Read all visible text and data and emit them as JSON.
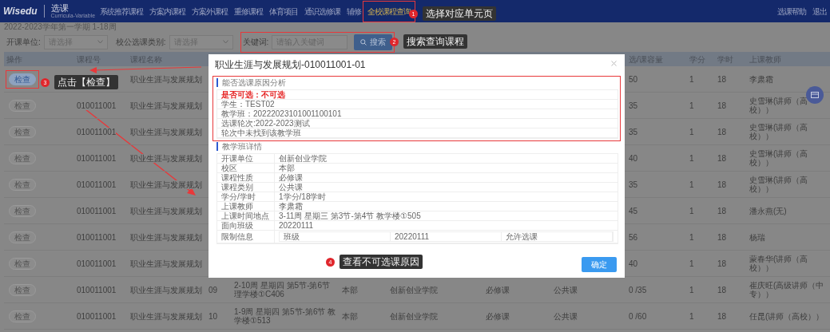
{
  "nav": {
    "brand": "Wisedu",
    "app": "选课",
    "app_subtitle": "Curricula-Variable",
    "items": [
      {
        "label": "系统推荐课程",
        "selected": false
      },
      {
        "label": "方案内课程",
        "selected": false
      },
      {
        "label": "方案外课程",
        "selected": false
      },
      {
        "label": "重修课程",
        "selected": false
      },
      {
        "label": "体育项目",
        "selected": false
      },
      {
        "label": "通识选修课",
        "selected": false
      },
      {
        "label": "辅修",
        "selected": false
      },
      {
        "label": "全校课程查询",
        "selected": true
      }
    ],
    "links": [
      "选课帮助",
      "退出"
    ]
  },
  "term": "2022-2023学年第一学期  1-18周",
  "filters": [
    {
      "kind": "select",
      "label": "开课单位:",
      "placeholder": "请选择"
    },
    {
      "kind": "select",
      "label": "校公选课类别:",
      "placeholder": "请选择"
    },
    {
      "kind": "input",
      "label": "关键词:",
      "placeholder": "请输入关键词"
    }
  ],
  "search_button": "搜索",
  "table": {
    "columns": [
      "操作",
      "课程号",
      "课程名称",
      "选/课容量",
      "学分",
      "学时",
      "上课教师"
    ],
    "rows": [
      {
        "action": "检查",
        "active": true,
        "course_name": "职业生涯与发展规划",
        "capacity": "50",
        "credits": "1",
        "hours": "18",
        "teacher": "李肃霜"
      },
      {
        "action": "检查",
        "active": false,
        "course_code": "010011001",
        "course_name": "职业生涯与发展规划",
        "capacity": "35",
        "credits": "1",
        "hours": "18",
        "teacher": "史雪琳(讲师（高校））"
      },
      {
        "action": "检查",
        "active": false,
        "course_code": "010011001",
        "course_name": "职业生涯与发展规划",
        "capacity": "35",
        "credits": "1",
        "hours": "18",
        "teacher": "史雪琳(讲师（高校））"
      },
      {
        "action": "检查",
        "active": false,
        "course_code": "010011001",
        "course_name": "职业生涯与发展规划",
        "capacity": "40",
        "credits": "1",
        "hours": "18",
        "teacher": "史雪琳(讲师（高校））"
      },
      {
        "action": "检查",
        "active": false,
        "course_code": "010011001",
        "course_name": "职业生涯与发展规划",
        "capacity": "35",
        "credits": "1",
        "hours": "18",
        "teacher": "史雪琳(讲师（高校））"
      },
      {
        "action": "检查",
        "active": false,
        "course_code": "010011001",
        "course_name": "职业生涯与发展规划",
        "capacity": "45",
        "credits": "1",
        "hours": "18",
        "teacher": "潘永燕(无)"
      },
      {
        "action": "检查",
        "active": false,
        "course_code": "010011001",
        "course_name": "职业生涯与发展规划",
        "capacity": "56",
        "credits": "1",
        "hours": "18",
        "teacher": "杨瑞"
      },
      {
        "action": "检查",
        "active": false,
        "course_code": "010011001",
        "course_name": "职业生涯与发展规划",
        "capacity": "40",
        "credits": "1",
        "hours": "18",
        "teacher": "蒙春华(讲师（高校））"
      },
      {
        "action": "检查",
        "active": false,
        "course_code": "010011001",
        "course_name": "职业生涯与发展规划",
        "column_4": "09",
        "column_5": "2-10周 星期四 第5节-第6节理学楼①C406",
        "column_6": "本部",
        "column_7": "创新创业学院",
        "column_8": "必修课",
        "column_9": "公共课",
        "capacity": "0 /35",
        "credits": "1",
        "hours": "18",
        "teacher": "崔庆旺(高级讲师（中专））"
      },
      {
        "action": "检查",
        "active": false,
        "course_code": "010011001",
        "course_name": "职业生涯与发展规划",
        "column_4": "10",
        "column_5": "1-9周 星期四 第5节-第6节 教学楼①513",
        "column_6": "本部",
        "column_7": "创新创业学院",
        "column_8": "必修课",
        "column_9": "公共课",
        "capacity": "0 /60",
        "credits": "1",
        "hours": "18",
        "teacher": "任昆(讲师（高校））"
      }
    ]
  },
  "modal": {
    "title": "职业生涯与发展规划-010011001-01",
    "analysis": {
      "heading": "能否选课原因分析",
      "lines": [
        {
          "text": "是否可选：不可选",
          "alert": true
        },
        {
          "text": "学生：TEST02",
          "alert": false
        },
        {
          "text": "教学班：20222023101001100101",
          "alert": false
        },
        {
          "text": "选课轮次:2022-2023测试",
          "alert": false
        },
        {
          "text": "轮次中未找到该教学班",
          "alert": false
        }
      ]
    },
    "details": {
      "heading": "教学班详情",
      "rows": [
        {
          "label": "开课单位",
          "value": "创新创业学院"
        },
        {
          "label": "校区",
          "value": "本部"
        },
        {
          "label": "课程性质",
          "value": "必修课"
        },
        {
          "label": "课程类别",
          "value": "公共课"
        },
        {
          "label": "学分/学时",
          "value": "1学分/18学时"
        },
        {
          "label": "上课教师",
          "value": "李肃霜"
        },
        {
          "label": "上课时间地点",
          "value": "3-11周 星期三 第3节-第4节 教学楼①505"
        },
        {
          "label": "面向班级",
          "value": "20220111"
        },
        {
          "label": "限制信息",
          "cells": [
            "班级",
            "20220111",
            "允许选课"
          ]
        }
      ]
    },
    "ok_button": "确定"
  },
  "annotations": [
    {
      "number": "1",
      "text": "选择对应单元页"
    },
    {
      "number": "2",
      "text": "搜索查询课程"
    },
    {
      "number": "3",
      "text": "点击【检查】"
    },
    {
      "number": "4",
      "text": "查看不可选课原因"
    }
  ]
}
